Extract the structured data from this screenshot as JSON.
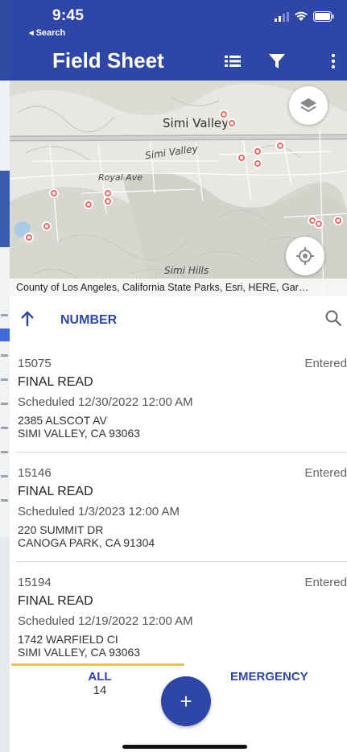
{
  "status_bar": {
    "time": "9:45",
    "back_label": "◂ Search"
  },
  "header": {
    "title": "Field Sheet",
    "list_icon": "list-icon",
    "filter_icon": "filter-icon",
    "more_icon": "more-vertical-icon"
  },
  "map": {
    "labels": {
      "city": "Simi Valley",
      "road": "Simi Valley",
      "avenue": "Royal Ave",
      "hills": "Simi Hills"
    },
    "attribution": "County of Los Angeles, California State Parks, Esri, HERE, Gar…",
    "layers_icon": "layers-icon",
    "locate_icon": "locate-icon"
  },
  "sort": {
    "direction_icon": "arrow-up-icon",
    "label": "NUMBER",
    "search_icon": "search-icon"
  },
  "work_orders": [
    {
      "number": "15075",
      "status": "Entered",
      "type": "FINAL READ",
      "scheduled": "Scheduled 12/30/2022 12:00 AM",
      "address_line1": "2385  ALSCOT AV",
      "address_line2": "SIMI VALLEY, CA 93063"
    },
    {
      "number": "15146",
      "status": "Entered",
      "type": "FINAL READ",
      "scheduled": "Scheduled 1/3/2023 12:00 AM",
      "address_line1": "220  SUMMIT DR",
      "address_line2": "CANOGA PARK, CA 91304"
    },
    {
      "number": "15194",
      "status": "Entered",
      "type": "FINAL READ",
      "scheduled": "Scheduled 12/19/2022 12:00 AM",
      "address_line1": "1742  WARFIELD CI",
      "address_line2": "SIMI VALLEY, CA 93063"
    }
  ],
  "tabs": {
    "all_label": "ALL",
    "all_count": "14",
    "emergency_label": "EMERGENCY",
    "add_label": "+"
  },
  "colors": {
    "brand": "#2e46a7",
    "pin": "#ef6767",
    "tab_indicator": "#f0c04d"
  }
}
